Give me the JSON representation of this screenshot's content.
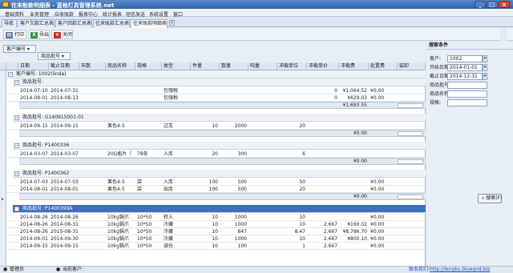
{
  "window": {
    "title": "往来账款明细表 - 蓝格灯具管理系统.net",
    "min": "_",
    "max": "□",
    "close": "×"
  },
  "menu": [
    "基础资料",
    "业务管理",
    "应收账款",
    "报表中心",
    "统计报表",
    "短信发送",
    "系统设置",
    "窗口"
  ],
  "tabs": [
    "导航",
    "客户欠款汇总表",
    "客户回款汇总表",
    "往来账款汇总表",
    "往来账款明细表"
  ],
  "toolbar": {
    "print": "打印",
    "export": "导出",
    "close": "关闭"
  },
  "group_chips": {
    "customer": "客户编号",
    "batch": "商品批号"
  },
  "columns": [
    "日期",
    "截止日期",
    "天数",
    "商品名称",
    "规格",
    "类型",
    "件量",
    "数量",
    "吨量",
    "冲裁单位",
    "冲裁单价",
    "冲裁费",
    "处置费",
    "装卸"
  ],
  "customer_group": "客户编号: 1002(linda)",
  "groups": [
    {
      "label": "商品批号:",
      "rows": [
        [
          "2014-07-10",
          "2014-07-31",
          "",
          "",
          "",
          "包强税",
          "",
          "",
          "",
          "",
          "0",
          "¥1,064.52",
          "¥0.00",
          ""
        ],
        [
          "2014-08-01",
          "2014-08-13",
          "",
          "",
          "",
          "包强税",
          "",
          "",
          "",
          "",
          "0",
          "¥629.03",
          "¥0.00",
          ""
        ]
      ],
      "total": "¥1,693.55"
    },
    {
      "label": "商品批号: G140915001-01",
      "rows": [
        [
          "2014-09-15",
          "2014-09-15",
          "",
          "果色4-5",
          "",
          "过车",
          "10",
          "2000",
          "",
          "20",
          "",
          "",
          "",
          ""
        ]
      ],
      "total": "¥0.00"
    },
    {
      "label": "商品批号: P1400336",
      "rows": [
        [
          "2014-03-07",
          "2014-03-07",
          "",
          "20G瓶片（",
          "78条",
          "入库",
          "20",
          "300",
          "",
          "6",
          "",
          "",
          "",
          ""
        ]
      ],
      "total": "¥0.00"
    },
    {
      "label": "商品批号: P1400362",
      "rows": [
        [
          "2014-07-03",
          "2014-07-03",
          "",
          "果色4-5",
          "袋",
          "入库",
          "100",
          "500",
          "",
          "50",
          "",
          "",
          "¥0.00",
          ""
        ],
        [
          "2014-08-01",
          "2014-08-01",
          "",
          "果色4-5",
          "袋",
          "出库",
          "100",
          "500",
          "",
          "20",
          "",
          "",
          "¥0.00",
          ""
        ]
      ],
      "total": "¥0.00"
    },
    {
      "label": "商品批号: P1400399A",
      "selected": true,
      "rows": [
        [
          "2014-08-26",
          "2014-08-26",
          "",
          "10kg锅爪",
          "10*50",
          "转入",
          "10",
          "1000",
          "",
          "10",
          "",
          "",
          "¥0.00",
          ""
        ],
        [
          "2014-08-26",
          "2014-08-31",
          "",
          "10kg锅爪",
          "10*50",
          "冷藏",
          "10",
          "1000",
          "",
          "10",
          "2.667",
          "¥160.02",
          "¥0.00",
          ""
        ],
        [
          "2014-08-26",
          "2015-08-31",
          "",
          "10kg锅爪",
          "10*50",
          "冷藏",
          "10",
          "847",
          "",
          "8.47",
          "2.667",
          "¥8,786.70",
          "¥0.00",
          ""
        ],
        [
          "2014-09-01",
          "2014-09-30",
          "",
          "10kg锅爪",
          "10*50",
          "冷藏",
          "10",
          "1000",
          "",
          "10",
          "2.667",
          "¥800.10",
          "¥0.00",
          ""
        ],
        [
          "2014-09-15",
          "2014-09-15",
          "",
          "10kg锅爪",
          "10*50",
          "调仓",
          "10",
          "100",
          "",
          "1",
          "2.667",
          "",
          "¥0.00",
          ""
        ]
      ]
    }
  ],
  "search_panel": {
    "title": "搜索条件",
    "customer_label": "客户:",
    "customer_value": "1002",
    "start_label": "开始日期:",
    "start_value": "2014-01-01",
    "end_label": "截止日期:",
    "end_value": "2014-12-31",
    "batch_label": "商品批号:",
    "name_label": "商品名称:",
    "spec_label": "规格:",
    "button": "搜索(F)"
  },
  "status": {
    "user_label": "管理员",
    "customer_label": "当前客户:",
    "contact": "联系我们:",
    "url": "http://lengku.bluegnd.biz"
  },
  "colors": {
    "title": "#2e62a8",
    "selected_group": "#3f6fc4",
    "link": "#1f4fb3"
  }
}
